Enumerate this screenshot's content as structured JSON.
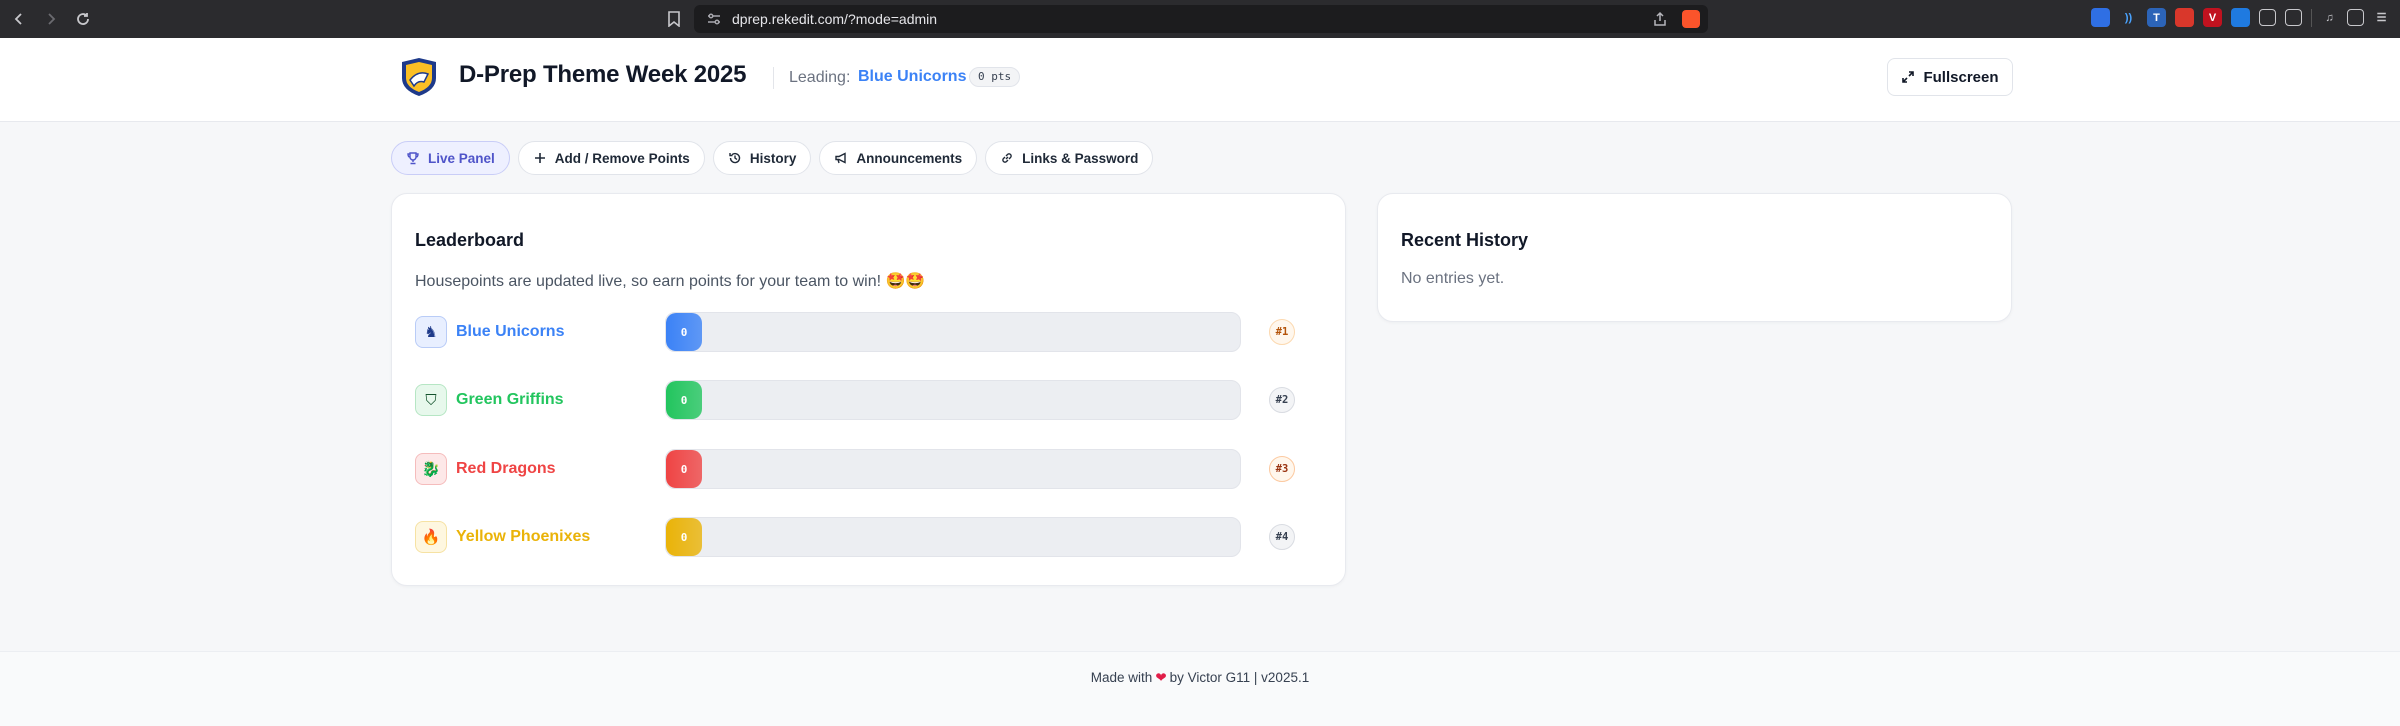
{
  "browser": {
    "url": "dprep.rekedit.com/?mode=admin"
  },
  "header": {
    "title": "D-Prep Theme Week 2025",
    "leading_label": "Leading:",
    "leading_team": "Blue Unicorns",
    "leading_points": "0 pts",
    "fullscreen_label": "Fullscreen"
  },
  "tabs": [
    {
      "label": "Live Panel",
      "icon": "trophy-icon",
      "active": true
    },
    {
      "label": "Add / Remove Points",
      "icon": "plus-icon",
      "active": false
    },
    {
      "label": "History",
      "icon": "history-icon",
      "active": false
    },
    {
      "label": "Announcements",
      "icon": "megaphone-icon",
      "active": false
    },
    {
      "label": "Links & Password",
      "icon": "link-icon",
      "active": false
    }
  ],
  "leaderboard": {
    "title": "Leaderboard",
    "subtitle": "Housepoints are updated live, so earn points for your team to win! 🤩🤩",
    "teams": [
      {
        "name": "Blue Unicorns",
        "points": "0",
        "rank": "#1",
        "icon": "unicorn-icon",
        "color": "#3b82f6",
        "progress": 0
      },
      {
        "name": "Green Griffins",
        "points": "0",
        "rank": "#2",
        "icon": "shield-icon",
        "color": "#22c55e",
        "progress": 0
      },
      {
        "name": "Red Dragons",
        "points": "0",
        "rank": "#3",
        "icon": "dragon-icon",
        "color": "#ef4444",
        "progress": 0
      },
      {
        "name": "Yellow Phoenixes",
        "points": "0",
        "rank": "#4",
        "icon": "flame-icon",
        "color": "#eab308",
        "progress": 0
      }
    ]
  },
  "history": {
    "title": "Recent History",
    "empty_text": "No entries yet."
  },
  "footer": {
    "made_with": "Made with",
    "by": "by Victor G11 | v2025.1"
  }
}
